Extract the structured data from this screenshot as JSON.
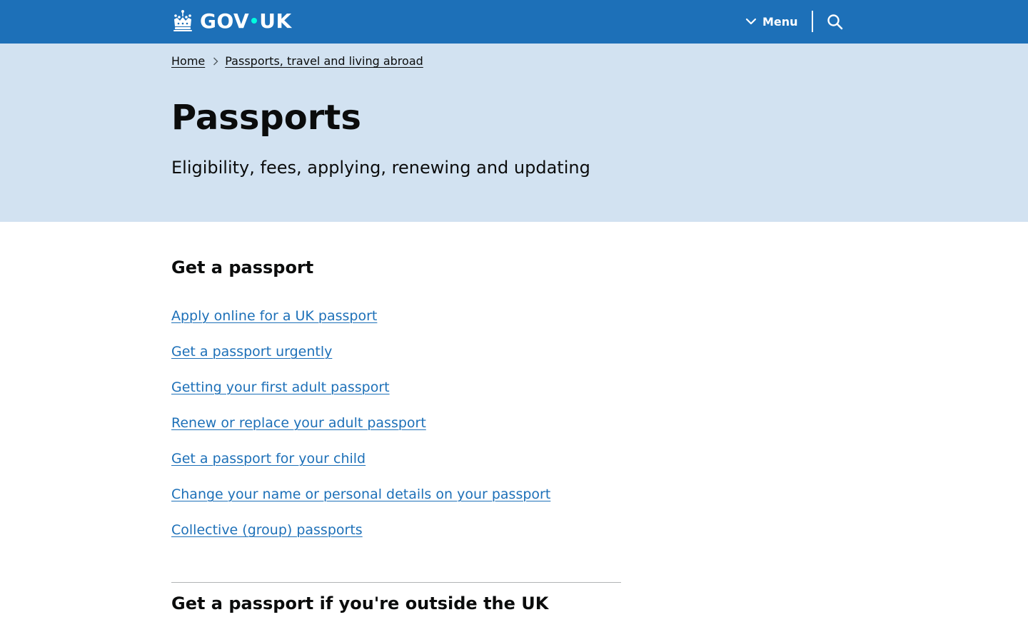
{
  "header": {
    "logo_text_left": "GOV",
    "logo_text_right": "UK",
    "menu_label": "Menu",
    "brand_color": "#1d70b8",
    "logo_dot_color": "#00ffe0",
    "icons": {
      "logo": "crown-icon",
      "menu": "chevron-down-icon",
      "search": "search-icon"
    }
  },
  "breadcrumb": {
    "items": [
      {
        "label": "Home"
      },
      {
        "label": "Passports, travel and living abroad"
      }
    ]
  },
  "hero": {
    "title": "Passports",
    "lede": "Eligibility, fees, applying, renewing and updating",
    "background": "#d2e2f1"
  },
  "sections": [
    {
      "heading": "Get a passport",
      "links": [
        "Apply online for a UK passport",
        "Get a passport urgently",
        "Getting your first adult passport",
        "Renew or replace your adult passport",
        "Get a passport for your child",
        "Change your name or personal details on your passport",
        "Collective (group) passports"
      ]
    },
    {
      "heading": "Get a passport if you're outside the UK"
    }
  ],
  "link_color": "#1d70b8"
}
